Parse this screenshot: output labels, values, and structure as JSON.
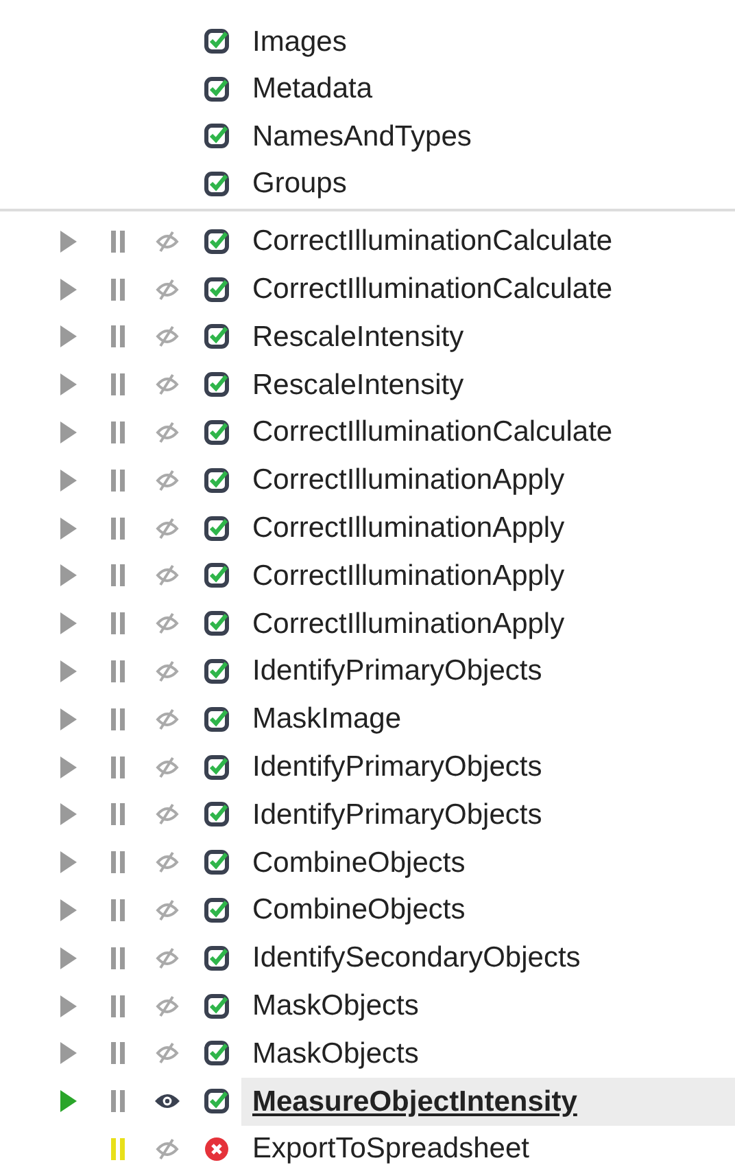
{
  "input_modules": [
    {
      "name": "Images",
      "enabled": true
    },
    {
      "name": "Metadata",
      "enabled": true
    },
    {
      "name": "NamesAndTypes",
      "enabled": true
    },
    {
      "name": "Groups",
      "enabled": true
    }
  ],
  "modules": [
    {
      "name": "CorrectIlluminationCalculate",
      "arrow_shown": true,
      "current": false,
      "paused": false,
      "display": false,
      "error": false,
      "selected": false
    },
    {
      "name": "CorrectIlluminationCalculate",
      "arrow_shown": true,
      "current": false,
      "paused": false,
      "display": false,
      "error": false,
      "selected": false
    },
    {
      "name": "RescaleIntensity",
      "arrow_shown": true,
      "current": false,
      "paused": false,
      "display": false,
      "error": false,
      "selected": false
    },
    {
      "name": "RescaleIntensity",
      "arrow_shown": true,
      "current": false,
      "paused": false,
      "display": false,
      "error": false,
      "selected": false
    },
    {
      "name": "CorrectIlluminationCalculate",
      "arrow_shown": true,
      "current": false,
      "paused": false,
      "display": false,
      "error": false,
      "selected": false
    },
    {
      "name": "CorrectIlluminationApply",
      "arrow_shown": true,
      "current": false,
      "paused": false,
      "display": false,
      "error": false,
      "selected": false
    },
    {
      "name": "CorrectIlluminationApply",
      "arrow_shown": true,
      "current": false,
      "paused": false,
      "display": false,
      "error": false,
      "selected": false
    },
    {
      "name": "CorrectIlluminationApply",
      "arrow_shown": true,
      "current": false,
      "paused": false,
      "display": false,
      "error": false,
      "selected": false
    },
    {
      "name": "CorrectIlluminationApply",
      "arrow_shown": true,
      "current": false,
      "paused": false,
      "display": false,
      "error": false,
      "selected": false
    },
    {
      "name": "IdentifyPrimaryObjects",
      "arrow_shown": true,
      "current": false,
      "paused": false,
      "display": false,
      "error": false,
      "selected": false
    },
    {
      "name": "MaskImage",
      "arrow_shown": true,
      "current": false,
      "paused": false,
      "display": false,
      "error": false,
      "selected": false
    },
    {
      "name": "IdentifyPrimaryObjects",
      "arrow_shown": true,
      "current": false,
      "paused": false,
      "display": false,
      "error": false,
      "selected": false
    },
    {
      "name": "IdentifyPrimaryObjects",
      "arrow_shown": true,
      "current": false,
      "paused": false,
      "display": false,
      "error": false,
      "selected": false
    },
    {
      "name": "CombineObjects",
      "arrow_shown": true,
      "current": false,
      "paused": false,
      "display": false,
      "error": false,
      "selected": false
    },
    {
      "name": "CombineObjects",
      "arrow_shown": true,
      "current": false,
      "paused": false,
      "display": false,
      "error": false,
      "selected": false
    },
    {
      "name": "IdentifySecondaryObjects",
      "arrow_shown": true,
      "current": false,
      "paused": false,
      "display": false,
      "error": false,
      "selected": false
    },
    {
      "name": "MaskObjects",
      "arrow_shown": true,
      "current": false,
      "paused": false,
      "display": false,
      "error": false,
      "selected": false
    },
    {
      "name": "MaskObjects",
      "arrow_shown": true,
      "current": false,
      "paused": false,
      "display": false,
      "error": false,
      "selected": false
    },
    {
      "name": "MeasureObjectIntensity",
      "arrow_shown": true,
      "current": true,
      "paused": false,
      "display": true,
      "error": false,
      "selected": true
    },
    {
      "name": "ExportToSpreadsheet",
      "arrow_shown": false,
      "paused": true,
      "display": false,
      "error": true,
      "selected": false
    }
  ]
}
